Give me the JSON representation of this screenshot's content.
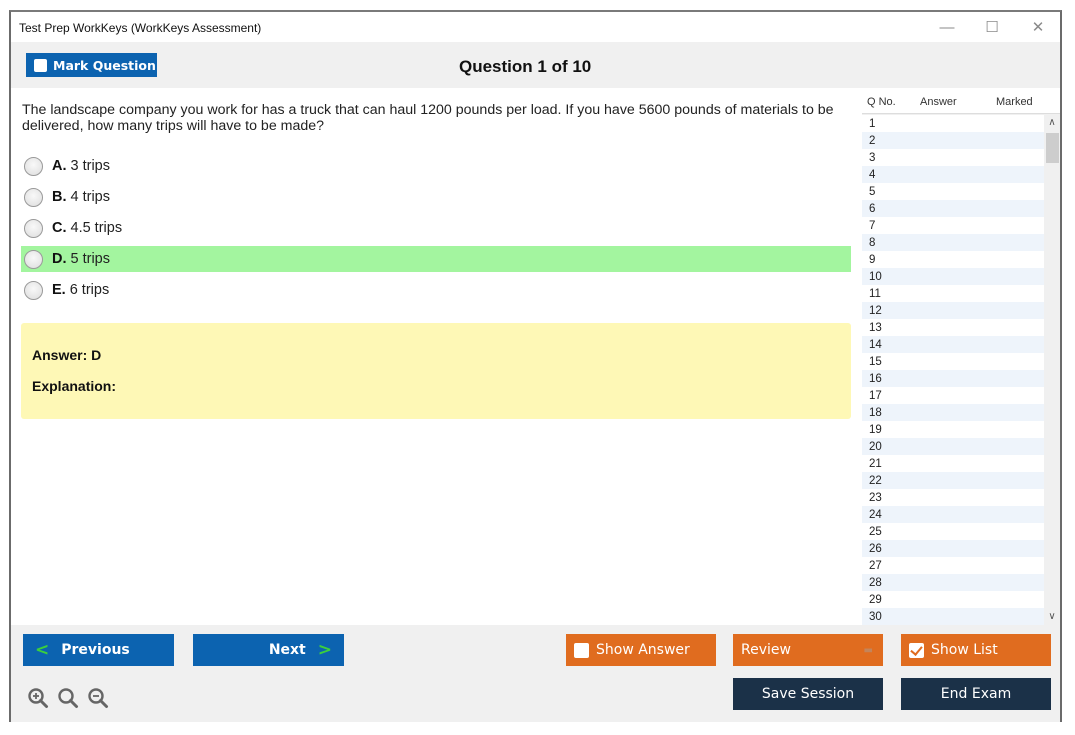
{
  "window": {
    "title": "Test Prep WorkKeys (WorkKeys Assessment)",
    "controls": {
      "minimize": "—",
      "maximize": "☐",
      "close": "✕"
    }
  },
  "toolbar": {
    "mark_question_label": "Mark Question",
    "question_counter": "Question 1 of 10"
  },
  "question": {
    "text": "The landscape company you work for has a truck that can haul 1200 pounds per load. If you have 5600 pounds of materials to be delivered, how many trips will have to be made?",
    "options": [
      {
        "letter": "A.",
        "text": "3 trips",
        "correct": false
      },
      {
        "letter": "B.",
        "text": "4 trips",
        "correct": false
      },
      {
        "letter": "C.",
        "text": "4.5 trips",
        "correct": false
      },
      {
        "letter": "D.",
        "text": "5 trips",
        "correct": true
      },
      {
        "letter": "E.",
        "text": "6 trips",
        "correct": false
      }
    ],
    "answer_label": "Answer: D",
    "explanation_label": "Explanation:"
  },
  "question_list": {
    "headers": {
      "qno": "Q No.",
      "answer": "Answer",
      "marked": "Marked"
    },
    "rows": [
      "1",
      "2",
      "3",
      "4",
      "5",
      "6",
      "7",
      "8",
      "9",
      "10",
      "11",
      "12",
      "13",
      "14",
      "15",
      "16",
      "17",
      "18",
      "19",
      "20",
      "21",
      "22",
      "23",
      "24",
      "25",
      "26",
      "27",
      "28",
      "29",
      "30"
    ],
    "scroll_up": "^",
    "scroll_down": "v"
  },
  "footer": {
    "previous_label": "Previous",
    "next_label": "Next",
    "prev_chevron": "<",
    "next_chevron": ">",
    "show_answer_label": "Show Answer",
    "show_answer_checked": false,
    "review_label": "Review",
    "review_dropdown": "▬",
    "show_list_label": "Show List",
    "show_list_checked": true,
    "save_session_label": "Save Session",
    "end_exam_label": "End Exam"
  },
  "colors": {
    "primary_blue": "#0c63b0",
    "orange": "#e06c1f",
    "dark_navy": "#1b3148",
    "correct_green": "#a3f59f",
    "answer_yellow": "#fef8b6",
    "chevron_green": "#3ccf3c"
  }
}
